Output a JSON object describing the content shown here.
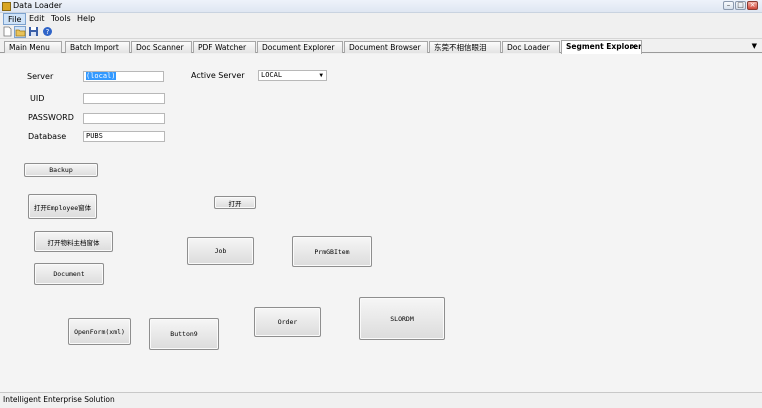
{
  "window": {
    "title": "Data Loader"
  },
  "menu": [
    "File",
    "Edit",
    "Tools",
    "Help"
  ],
  "tabs": [
    "Main Menu",
    "Batch Import",
    "Doc Scanner",
    "PDF Watcher",
    "Document Explorer",
    "Document Browser",
    "东莞不相信眼泪",
    "Doc Loader",
    "Segment Explorer"
  ],
  "form": {
    "server_label": "Server",
    "server_value": "(local)",
    "uid_label": "UID",
    "uid_value": "",
    "password_label": "PASSWORD",
    "password_value": "",
    "database_label": "Database",
    "database_value": "PUBS",
    "active_server_label": "Active Server",
    "active_server_value": "LOCAL"
  },
  "buttons": {
    "backup": "Backup",
    "open_employee": "打开Employee窗体",
    "open_small": "打开",
    "open_material": "打开物料主档窗体",
    "job": "Job",
    "prmgbitem": "PrmGBItem",
    "document": "Document",
    "openform": "OpenForm(xml)",
    "button9": "Button9",
    "order": "Order",
    "slordm": "SLORDM"
  },
  "status": {
    "text": "Intelligent Enterprise Solution"
  }
}
